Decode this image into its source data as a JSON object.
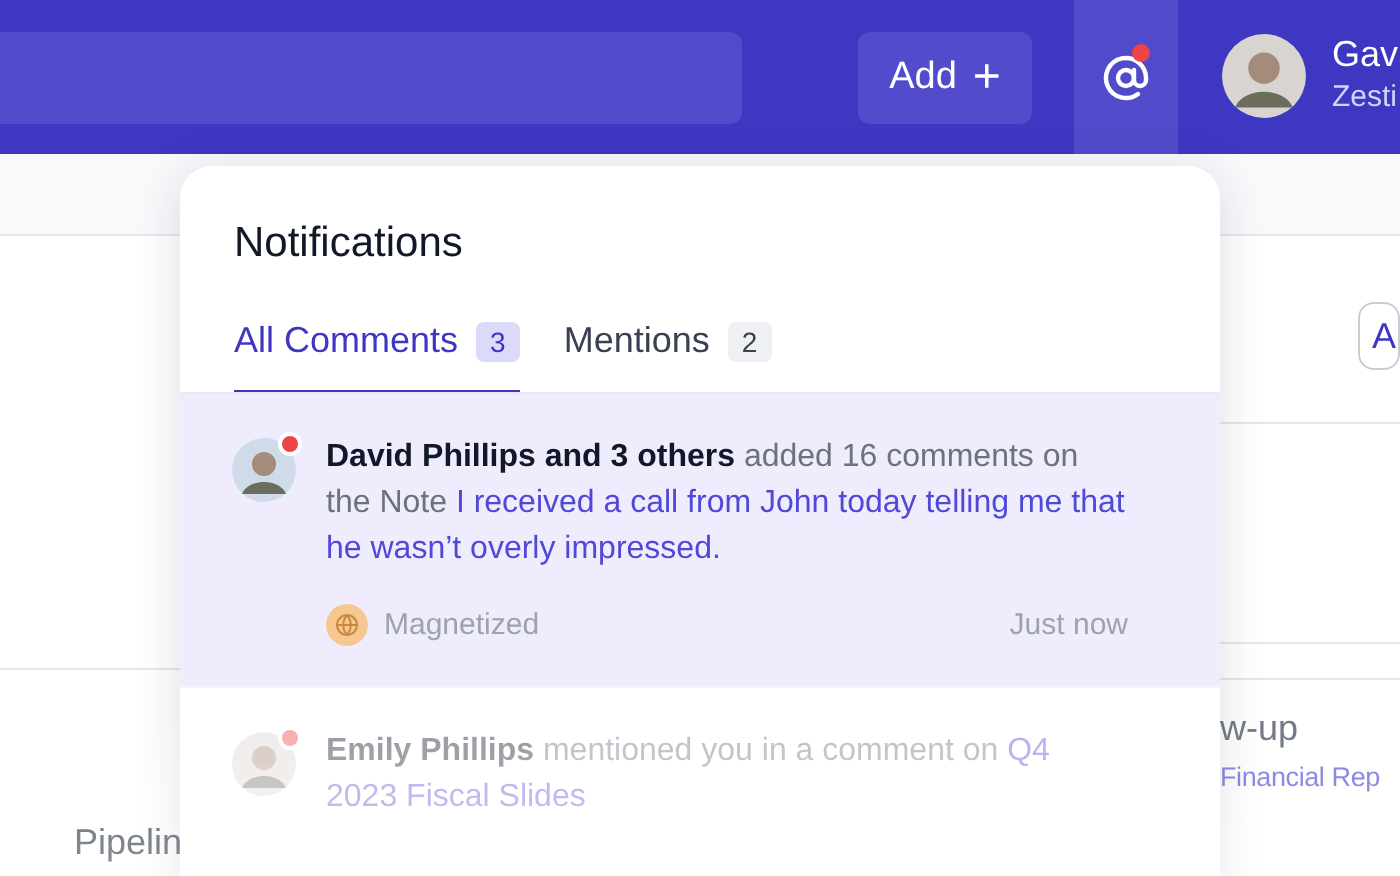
{
  "header": {
    "add_button": {
      "label": "Add",
      "icon": "+"
    },
    "mentions_button": {
      "unread": true
    },
    "user": {
      "name": "Gav",
      "company": "Zesti"
    }
  },
  "background": {
    "filter_button": "A",
    "task": {
      "title": "w-up",
      "link": "Financial Rep"
    },
    "section": "Pipelin"
  },
  "notifications": {
    "title": "Notifications",
    "tabs": [
      {
        "label": "All Comments",
        "count": "3",
        "selected": true
      },
      {
        "label": "Mentions",
        "count": "2",
        "selected": false
      }
    ],
    "items": [
      {
        "text": "**David Phillips and 3 others** added 16 comments on the Note",
        "target": "I received a call from John today telling me that he wasn’t overly impressed.",
        "unread": true,
        "highlighted": true,
        "source": "Magnetized",
        "time": "Just now"
      },
      {
        "text": "**Emily Phillips** mentioned you in a comment on",
        "target": "Q4 2023 Fiscal Slides",
        "unread": true,
        "highlighted": false
      }
    ]
  }
}
